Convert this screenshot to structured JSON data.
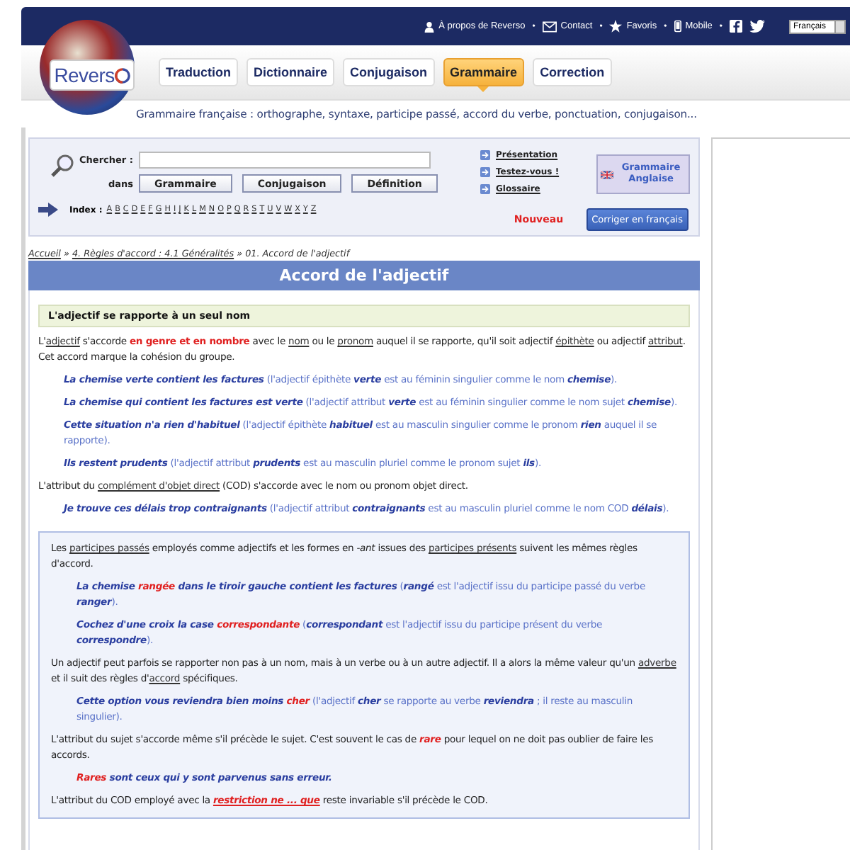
{
  "top_links": [
    {
      "label": "À propos de Reverso"
    },
    {
      "label": "Contact"
    },
    {
      "label": "Favoris"
    },
    {
      "label": "Mobile"
    }
  ],
  "bullet": "•",
  "language_select": {
    "value": "Français"
  },
  "logo": {
    "text": "Revers"
  },
  "nav_tabs": [
    {
      "label": "Traduction",
      "selected": false
    },
    {
      "label": "Dictionnaire",
      "selected": false
    },
    {
      "label": "Conjugaison",
      "selected": false
    },
    {
      "label": "Grammaire",
      "selected": true
    },
    {
      "label": "Correction",
      "selected": false
    }
  ],
  "tagline": "Grammaire française : orthographe, syntaxe, participe passé, accord du verbe, ponctuation, conjugaison...",
  "search": {
    "label": "Chercher :",
    "in_label": "dans",
    "buttons": [
      "Grammaire",
      "Conjugaison",
      "Définition"
    ],
    "index_label": "Index :",
    "letters": [
      "A",
      "B",
      "C",
      "D",
      "E",
      "F",
      "G",
      "H",
      "I",
      "J",
      "K",
      "L",
      "M",
      "N",
      "O",
      "P",
      "Q",
      "R",
      "S",
      "T",
      "U",
      "V",
      "W",
      "X",
      "Y",
      "Z"
    ],
    "side_links": [
      "Présentation",
      "Testez-vous !",
      "Glossaire"
    ],
    "english_grammar": "Grammaire Anglaise",
    "new_label": "Nouveau",
    "correct_button": "Corriger en français"
  },
  "breadcrumb": [
    {
      "kind": "link",
      "text": "Accueil"
    },
    {
      "kind": "text",
      "text": " » "
    },
    {
      "kind": "link",
      "text": "4. Règles d'accord : 4.1 Généralités"
    },
    {
      "kind": "text",
      "text": " » 01. Accord de l'adjectif"
    }
  ],
  "title": "Accord de l'adjectif",
  "section_heading": "L'adjectif se rapporte à un seul nom",
  "content": [
    {
      "kind": "para",
      "segments": [
        {
          "kind": "text",
          "text": "L'"
        },
        {
          "kind": "link",
          "text": "adjectif"
        },
        {
          "kind": "text",
          "text": " s'accorde "
        },
        {
          "kind": "red",
          "text": "en genre et en nombre"
        },
        {
          "kind": "text",
          "text": " avec le "
        },
        {
          "kind": "link",
          "text": "nom"
        },
        {
          "kind": "text",
          "text": " ou le "
        },
        {
          "kind": "link",
          "text": "pronom"
        },
        {
          "kind": "text",
          "text": " auquel il se rapporte, qu'il soit adjectif "
        },
        {
          "kind": "link",
          "text": "épithète"
        },
        {
          "kind": "text",
          "text": " ou adjectif "
        },
        {
          "kind": "link",
          "text": "attribut"
        },
        {
          "kind": "text",
          "text": ". Cet accord marque la cohésion du groupe."
        }
      ]
    },
    {
      "kind": "example",
      "segments": [
        {
          "kind": "ex",
          "text": "La chemise verte contient les factures"
        },
        {
          "kind": "gloss",
          "text": " (l'adjectif épithète "
        },
        {
          "kind": "ex",
          "text": "verte"
        },
        {
          "kind": "gloss",
          "text": " est au féminin singulier comme le nom "
        },
        {
          "kind": "ex",
          "text": "chemise"
        },
        {
          "kind": "gloss",
          "text": ")."
        }
      ]
    },
    {
      "kind": "example",
      "segments": [
        {
          "kind": "ex",
          "text": "La chemise qui contient les factures est verte"
        },
        {
          "kind": "gloss",
          "text": " (l'adjectif attribut "
        },
        {
          "kind": "ex",
          "text": "verte"
        },
        {
          "kind": "gloss",
          "text": " est au féminin singulier comme le nom sujet "
        },
        {
          "kind": "ex",
          "text": "chemise"
        },
        {
          "kind": "gloss",
          "text": ")."
        }
      ]
    },
    {
      "kind": "example",
      "segments": [
        {
          "kind": "ex",
          "text": "Cette situation n'a rien d'habituel"
        },
        {
          "kind": "gloss",
          "text": " (l'adjectif épithète "
        },
        {
          "kind": "ex",
          "text": "habituel"
        },
        {
          "kind": "gloss",
          "text": " est au masculin singulier comme le pronom "
        },
        {
          "kind": "ex",
          "text": "rien"
        },
        {
          "kind": "gloss",
          "text": " auquel il se rapporte)."
        }
      ]
    },
    {
      "kind": "example",
      "segments": [
        {
          "kind": "ex",
          "text": "Ils restent prudents"
        },
        {
          "kind": "gloss",
          "text": " (l'adjectif attribut "
        },
        {
          "kind": "ex",
          "text": "prudents"
        },
        {
          "kind": "gloss",
          "text": " est au masculin pluriel comme le pronom sujet "
        },
        {
          "kind": "ex",
          "text": "ils"
        },
        {
          "kind": "gloss",
          "text": ")."
        }
      ]
    },
    {
      "kind": "para",
      "segments": [
        {
          "kind": "text",
          "text": "L'attribut du "
        },
        {
          "kind": "link",
          "text": "complément d'objet direct"
        },
        {
          "kind": "text",
          "text": " (COD) s'accorde avec le nom ou pronom objet direct."
        }
      ]
    },
    {
      "kind": "example",
      "segments": [
        {
          "kind": "ex",
          "text": "Je trouve ces délais trop contraignants"
        },
        {
          "kind": "gloss",
          "text": " (l'adjectif attribut "
        },
        {
          "kind": "ex",
          "text": "contraignants"
        },
        {
          "kind": "gloss",
          "text": " est au masculin pluriel comme le nom COD "
        },
        {
          "kind": "ex",
          "text": "délais"
        },
        {
          "kind": "gloss",
          "text": ")."
        }
      ]
    }
  ],
  "box": [
    {
      "kind": "para",
      "segments": [
        {
          "kind": "text",
          "text": "Les "
        },
        {
          "kind": "link",
          "text": "participes passés"
        },
        {
          "kind": "text",
          "text": " employés comme adjectifs et les formes en "
        },
        {
          "kind": "italic",
          "text": "-ant"
        },
        {
          "kind": "text",
          "text": " issues des "
        },
        {
          "kind": "link",
          "text": "participes présents"
        },
        {
          "kind": "text",
          "text": " suivent les mêmes règles d'accord."
        }
      ]
    },
    {
      "kind": "example",
      "segments": [
        {
          "kind": "ex",
          "text": "La chemise "
        },
        {
          "kind": "exred",
          "text": "rangée"
        },
        {
          "kind": "ex",
          "text": " dans le tiroir gauche contient les factures"
        },
        {
          "kind": "gloss",
          "text": " ("
        },
        {
          "kind": "ex",
          "text": "rangé"
        },
        {
          "kind": "gloss",
          "text": " est l'adjectif issu du participe passé du verbe "
        },
        {
          "kind": "ex",
          "text": "ranger"
        },
        {
          "kind": "gloss",
          "text": ")."
        }
      ]
    },
    {
      "kind": "example",
      "segments": [
        {
          "kind": "ex",
          "text": "Cochez d'une croix la case "
        },
        {
          "kind": "exred",
          "text": "correspondante"
        },
        {
          "kind": "gloss",
          "text": " ("
        },
        {
          "kind": "ex",
          "text": "correspondant"
        },
        {
          "kind": "gloss",
          "text": " est l'adjectif issu du participe présent du verbe "
        },
        {
          "kind": "ex",
          "text": "correspondre"
        },
        {
          "kind": "gloss",
          "text": ")."
        }
      ]
    },
    {
      "kind": "para",
      "segments": [
        {
          "kind": "text",
          "text": "Un adjectif peut parfois se rapporter non pas à un nom, mais à un verbe ou à un autre adjectif. Il a alors la même valeur qu'un "
        },
        {
          "kind": "link",
          "text": "adverbe"
        },
        {
          "kind": "text",
          "text": " et il suit des règles d'"
        },
        {
          "kind": "link",
          "text": "accord"
        },
        {
          "kind": "text",
          "text": " spécifiques."
        }
      ]
    },
    {
      "kind": "example",
      "segments": [
        {
          "kind": "ex",
          "text": "Cette option vous reviendra bien moins "
        },
        {
          "kind": "exred",
          "text": "cher"
        },
        {
          "kind": "gloss",
          "text": " (l'adjectif "
        },
        {
          "kind": "ex",
          "text": "cher"
        },
        {
          "kind": "gloss",
          "text": " se rapporte au verbe "
        },
        {
          "kind": "ex",
          "text": "reviendra"
        },
        {
          "kind": "gloss",
          "text": " ; il reste au masculin singulier)."
        }
      ]
    },
    {
      "kind": "para",
      "segments": [
        {
          "kind": "text",
          "text": "L'attribut du sujet s'accorde même s'il précède le sujet. C'est souvent le cas de "
        },
        {
          "kind": "exred",
          "text": "rare"
        },
        {
          "kind": "text",
          "text": " pour lequel on ne doit pas oublier de faire les accords."
        }
      ]
    },
    {
      "kind": "example",
      "segments": [
        {
          "kind": "exred",
          "text": "Rares"
        },
        {
          "kind": "ex",
          "text": " sont ceux qui y sont parvenus sans erreur."
        }
      ]
    },
    {
      "kind": "para",
      "segments": [
        {
          "kind": "text",
          "text": "L'attribut du COD employé avec la "
        },
        {
          "kind": "redlink",
          "text": "restriction ne ... que"
        },
        {
          "kind": "text",
          "text": " reste invariable s'il précède le COD."
        }
      ]
    }
  ]
}
